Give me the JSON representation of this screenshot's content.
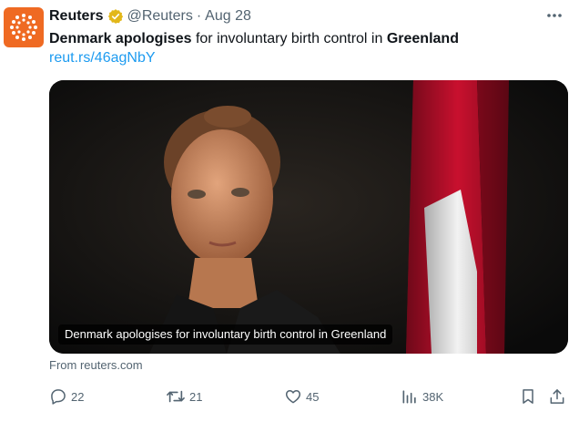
{
  "author": {
    "name": "Reuters",
    "handle": "@Reuters",
    "separator": "·",
    "date": "Aug 28",
    "verified_icon": "verified-badge-icon"
  },
  "tweet": {
    "text_part1": "Denmark apologises",
    "text_part2": " for involuntary birth control in ",
    "text_part3": "Greenland",
    "link": "reut.rs/46agNbY"
  },
  "card": {
    "caption": "Denmark apologises for involuntary birth control in Greenland",
    "source": "From reuters.com"
  },
  "actions": {
    "replies": "22",
    "retweets": "21",
    "likes": "45",
    "views": "38K"
  },
  "colors": {
    "brand_avatar": "#ef6a23",
    "link": "#1d9bf0",
    "muted": "#536471",
    "verified": "#e2b719"
  }
}
